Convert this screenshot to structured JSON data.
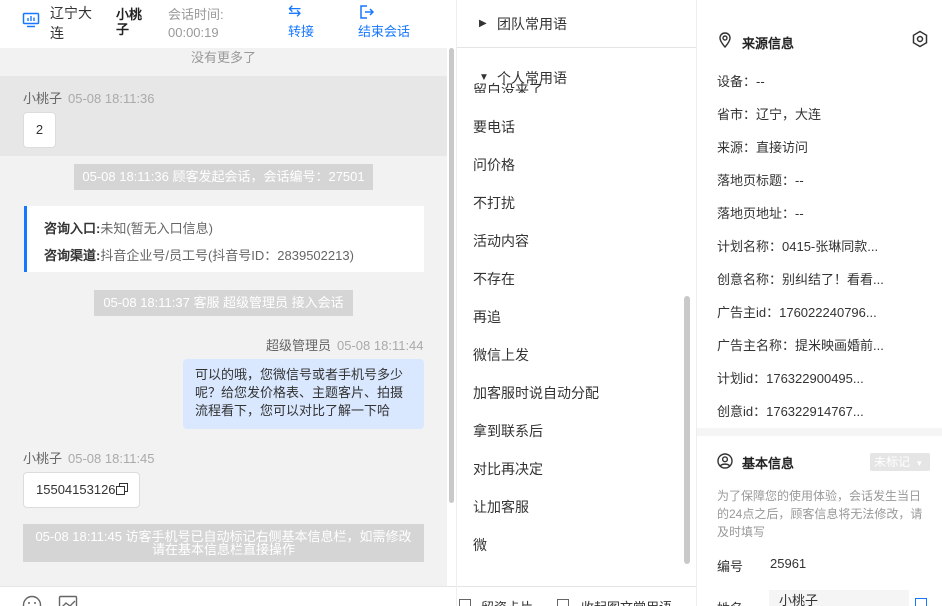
{
  "header": {
    "city": "辽宁大连",
    "visitor_name": "小桃子",
    "session_time_label": "会话时间:",
    "session_time_value": "00:00:19",
    "transfer_label": "转接",
    "end_label": "结束会话"
  },
  "messages": {
    "no_more": "没有更多了",
    "visitor1_name": "小桃子",
    "visitor1_time": "05-08 18:11:36",
    "visitor1_text": "2",
    "sys1": "05-08 18:11:36 顾客发起会话，会话编号：27501",
    "entry_label": "咨询入口:",
    "entry_value": "未知(暂无入口信息)",
    "channel_label": "咨询渠道:",
    "channel_value": "抖音企业号/员工号(抖音号ID：2839502213)",
    "sys2": "05-08 18:11:37 客服 超级管理员 接入会话",
    "agent_name": "超级管理员",
    "agent_time": "05-08 18:11:44",
    "agent_text": "可以的哦，您微信号或者手机号多少呢？给您发价格表、主题客片、拍摄流程看下，您可以对比了解一下哈",
    "visitor2_name": "小桃子",
    "visitor2_time": "05-08 18:11:45",
    "visitor2_text": "15504153126",
    "sys3": "05-08 18:11:45 访客手机号已自动标记右侧基本信息栏，如需修改请在基本信息栏直接操作"
  },
  "toolbar": {
    "emoji_icon": "smile-icon",
    "image_icon": "image-icon",
    "right1": "留资卡片",
    "right2": "收起图文常用语"
  },
  "phrases": {
    "team_group": "团队常用语",
    "personal_group": "个人常用语",
    "cut_item": "留白没来了",
    "items": [
      "要电话",
      "问价格",
      "不打扰",
      "活动内容",
      "不存在",
      "再追",
      "微信上发",
      "加客服时说自动分配",
      "拿到联系后",
      "对比再决定",
      "让加客服",
      "微"
    ]
  },
  "source_info": {
    "title": "来源信息",
    "rows": [
      "设备：--",
      "省市：辽宁，大连",
      "来源：直接访问",
      "落地页标题：--",
      "落地页地址：--",
      "计划名称：0415-张琳同款...",
      "创意名称：别纠结了！看看...",
      "广告主id：176022240796...",
      "广告主名称：提米映画婚前...",
      "计划id：176322900495...",
      "创意id：176322914767..."
    ]
  },
  "basic_info": {
    "title": "基本信息",
    "badge": "未标记",
    "note": "为了保障您的使用体验，会话发生当日的24点之后，顾客信息将无法修改，请及时填写",
    "id_label": "编号",
    "id_value": "25961",
    "name_label": "姓名",
    "name_value": "小桃子"
  },
  "colors": {
    "accent": "#1677ff",
    "chat_bg": "#f2f2f2",
    "agent_bubble": "#d9e8ff",
    "system_bar": "#d5d5d5"
  }
}
